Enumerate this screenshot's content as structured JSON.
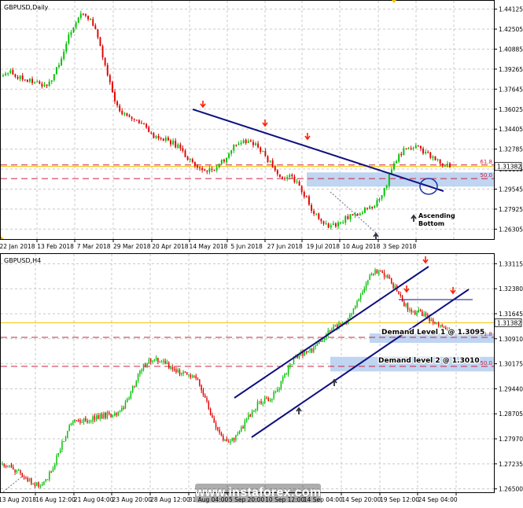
{
  "colors": {
    "background": "#ffffff",
    "grid": "#c8c8c8",
    "bull_candle": "#00c000",
    "bear_candle": "#e00000",
    "trendline": "#101080",
    "price_line": "#f2c000",
    "fib_line": "#d02040",
    "zone": "#b8d0f0",
    "annotation_arrow_up": "#303040",
    "annotation_arrow_down": "#ff2000"
  },
  "watermark": "www.instaforex.com",
  "chart_data": [
    {
      "type": "candlestick",
      "title": "GBPUSD,Daily",
      "ylim": [
        1.255,
        1.448
      ],
      "y_ticks": [
        "1.44125",
        "1.42505",
        "1.40885",
        "1.39265",
        "1.37645",
        "1.36025",
        "1.34405",
        "1.32785",
        "1.31165",
        "1.29545",
        "1.27925",
        "1.26305"
      ],
      "x_ticks": [
        "22 Jan 2018",
        "13 Feb 2018",
        "7 Mar 2018",
        "29 Mar 2018",
        "20 Apr 2018",
        "14 May 2018",
        "5 Jun 2018",
        "27 Jun 2018",
        "19 Jul 2018",
        "10 Aug 2018",
        "3 Sep 2018"
      ],
      "current_price_label": "1.31382",
      "current_price": 1.31382,
      "fib_levels": [
        {
          "label": "61.8",
          "value": 1.315
        },
        {
          "label": "50.0",
          "value": 1.304
        }
      ],
      "key_points": [
        {
          "date": "22 Jan 2018",
          "price": 1.39
        },
        {
          "date": "7 Mar 2018",
          "price": 1.38
        },
        {
          "date": "17 Apr 2018",
          "price": 1.437
        },
        {
          "date": "14 May 2018",
          "price": 1.355
        },
        {
          "date": "5 Jun 2018",
          "price": 1.335
        },
        {
          "date": "27 Jun 2018",
          "price": 1.31
        },
        {
          "date": "9 Jul 2018",
          "price": 1.335
        },
        {
          "date": "19 Jul 2018",
          "price": 1.305
        },
        {
          "date": "10 Aug 2018",
          "price": 1.2662
        },
        {
          "date": "3 Sep 2018",
          "price": 1.279
        },
        {
          "date": "17 Sep 2018",
          "price": 1.33
        },
        {
          "date": "21 Sep 2018",
          "price": 1.315
        }
      ],
      "annotations": [
        {
          "text": "Ascending Bottom",
          "date": "3 Sep 2018",
          "price": 1.279
        }
      ]
    },
    {
      "type": "candlestick",
      "title": "GBPUSD,H4",
      "ylim": [
        1.264,
        1.334
      ],
      "y_ticks": [
        "1.33115",
        "1.32380",
        "1.31645",
        "1.30910",
        "1.30175",
        "1.29440",
        "1.28705",
        "1.27970",
        "1.27235",
        "1.26500"
      ],
      "x_ticks": [
        "13 Aug 2018",
        "16 Aug 12:00",
        "21 Aug 04:00",
        "23 Aug 20:00",
        "28 Aug 12:00",
        "31 Aug 04:00",
        "5 Sep 20:00",
        "10 Sep 12:00",
        "14 Sep 04:00",
        "14 Sep 20:00",
        "19 Sep 12:00",
        "24 Sep 04:00"
      ],
      "current_price_label": "1.31382",
      "current_price": 1.31382,
      "fib_levels": [
        {
          "label": "61.8",
          "value": 1.3095
        },
        {
          "label": "50.0",
          "value": 1.301
        }
      ],
      "key_points": [
        {
          "date": "13 Aug 2018",
          "price": 1.272
        },
        {
          "date": "15 Aug 2018",
          "price": 1.2665
        },
        {
          "date": "21 Aug 2018",
          "price": 1.285
        },
        {
          "date": "23 Aug 2018",
          "price": 1.287
        },
        {
          "date": "28 Aug 2018",
          "price": 1.303
        },
        {
          "date": "30 Aug 2018",
          "price": 1.2985
        },
        {
          "date": "31 Aug 2018",
          "price": 1.279
        },
        {
          "date": "6 Sep 2018",
          "price": 1.291
        },
        {
          "date": "10 Sep 2018",
          "price": 1.305
        },
        {
          "date": "14 Sep 2018",
          "price": 1.313
        },
        {
          "date": "20 Sep 2018",
          "price": 1.329
        },
        {
          "date": "21 Sep 2018",
          "price": 1.317
        },
        {
          "date": "24 Sep 2018",
          "price": 1.311
        }
      ],
      "annotations": [
        {
          "text": "Demand Level 1 @ 1.3095",
          "price": 1.3095
        },
        {
          "text": "Demand level 2 @ 1.3010",
          "price": 1.301
        }
      ]
    }
  ]
}
